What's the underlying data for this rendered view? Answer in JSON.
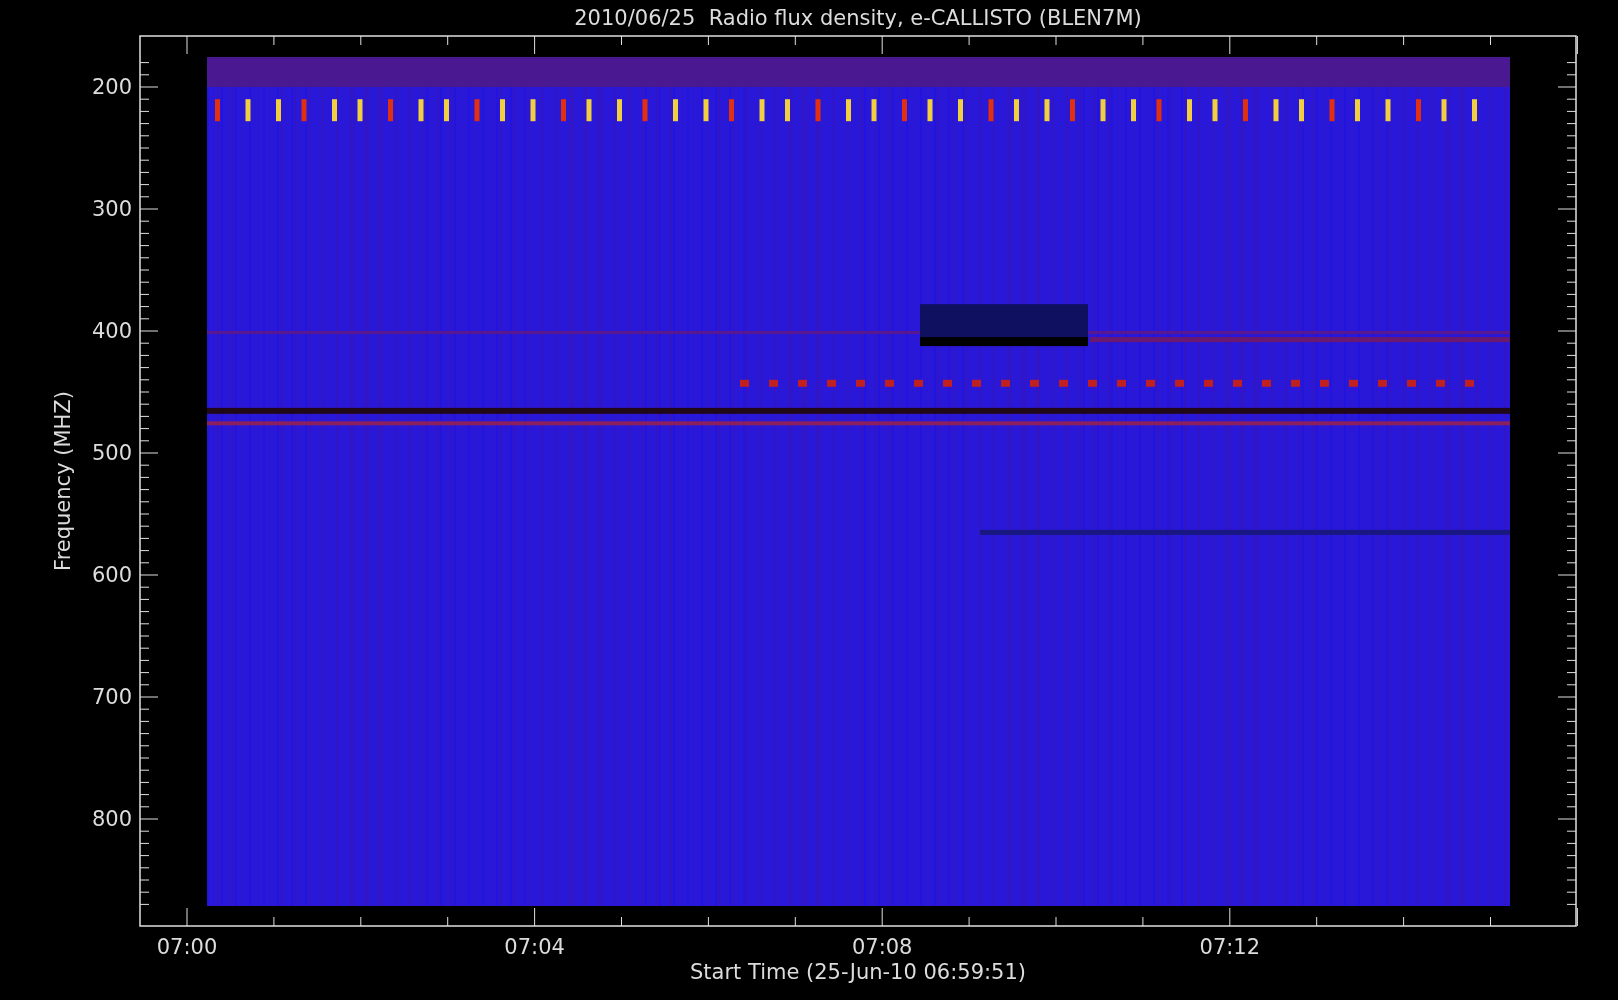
{
  "plot": {
    "title": "2010/06/25  Radio flux density, e-CALLISTO (BLEN7M)",
    "ylabel": "Frequency (MHZ)",
    "xlabel": "Start Time (25-Jun-10 06:59:51)",
    "y_tick_labels": [
      "200",
      "300",
      "400",
      "500",
      "600",
      "700",
      "800"
    ],
    "x_tick_labels": [
      "07:00",
      "07:04",
      "07:08",
      "07:12"
    ]
  }
}
